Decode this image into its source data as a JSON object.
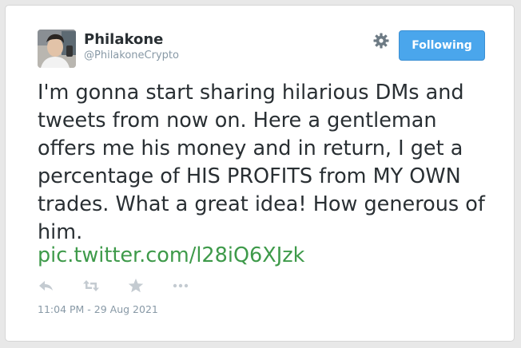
{
  "tweet": {
    "author": {
      "display_name": "Philakone",
      "handle": "@PhilakoneCrypto",
      "avatar_icon": "avatar-photo"
    },
    "settings_icon": "gear-icon",
    "follow_button_label": "Following",
    "text": "I'm gonna start sharing hilarious DMs and tweets from now on. Here a gentleman offers me his money and in return, I get a percentage of HIS PROFITS from MY OWN trades. What a great idea! How generous of him.",
    "link": "pic.twitter.com/l28iQ6XJzk",
    "actions": [
      "reply-icon",
      "retweet-icon",
      "favorite-icon",
      "more-icon"
    ],
    "timestamp": "11:04 PM - 29 Aug 2021"
  },
  "colors": {
    "follow_button_bg": "#4aa6ec",
    "link": "#3e9a4a",
    "text": "#292f33",
    "muted": "#8899a6"
  }
}
